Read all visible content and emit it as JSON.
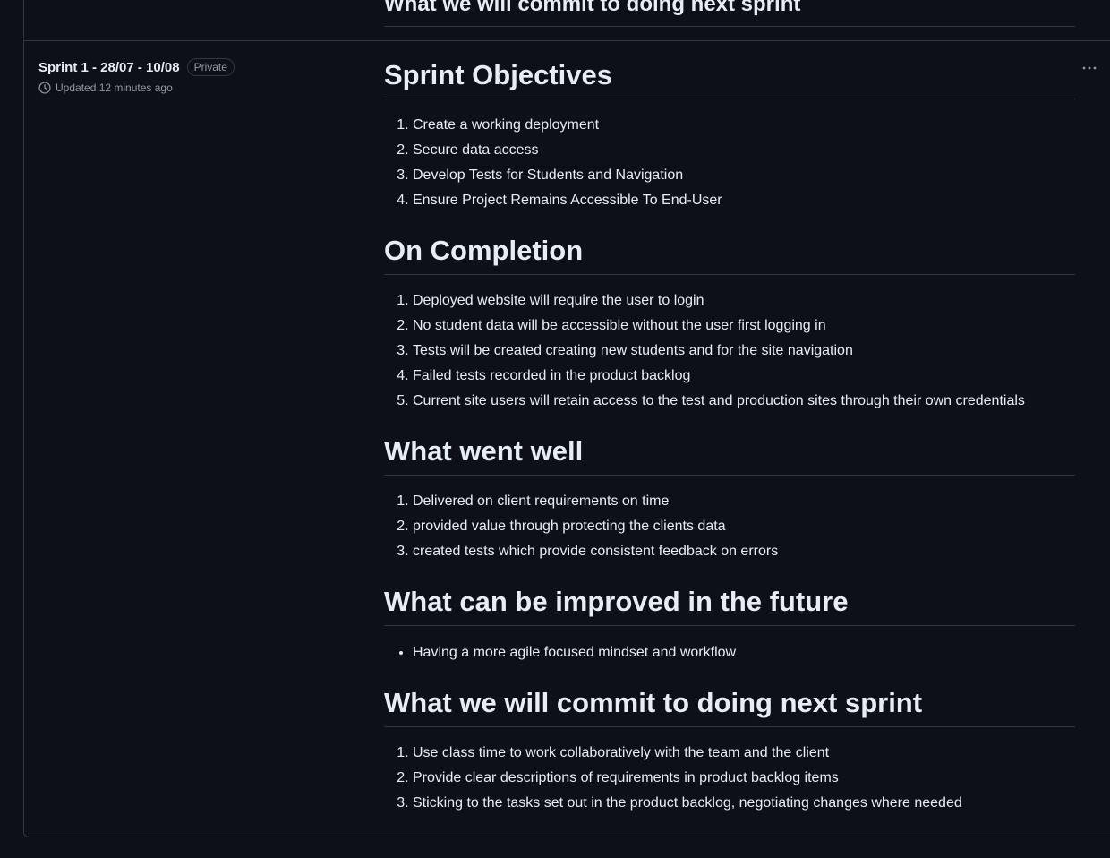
{
  "previous_gist": {
    "heading": "What we will commit to doing next sprint"
  },
  "gist": {
    "title": "Sprint 1 - 28/07 - 10/08",
    "visibility": "Private",
    "updated": "Updated 12 minutes ago",
    "more_label": "···"
  },
  "sections": [
    {
      "heading": "Sprint Objectives",
      "ordered": true,
      "items": [
        "Create a working deployment",
        "Secure data access",
        "Develop Tests for Students and Navigation",
        "Ensure Project Remains Accessible To End-User"
      ]
    },
    {
      "heading": "On Completion",
      "ordered": true,
      "items": [
        "Deployed website will require the user to login",
        "No student data will be accessible without the user first logging in",
        "Tests will be created creating new students and for the site navigation",
        "Failed tests recorded in the product backlog",
        "Current site users will retain access to the test and production sites through their own credentials"
      ]
    },
    {
      "heading": "What went well",
      "ordered": true,
      "items": [
        "Delivered on client requirements on time",
        "provided value through protecting the clients data",
        "created tests which provide consistent feedback on errors"
      ]
    },
    {
      "heading": "What can be improved in the future",
      "ordered": false,
      "items": [
        "Having a more agile focused mindset and workflow"
      ]
    },
    {
      "heading": "What we will commit to doing next sprint",
      "ordered": true,
      "items": [
        "Use class time to work collaboratively with the team and the client",
        "Provide clear descriptions of requirements in product backlog items",
        "Sticking to the tasks set out in the product backlog, negotiating changes where needed"
      ]
    }
  ],
  "colors": {
    "background": "#0d1117",
    "border": "#30363d",
    "text": "#e6edf3",
    "muted": "#9198a1"
  }
}
